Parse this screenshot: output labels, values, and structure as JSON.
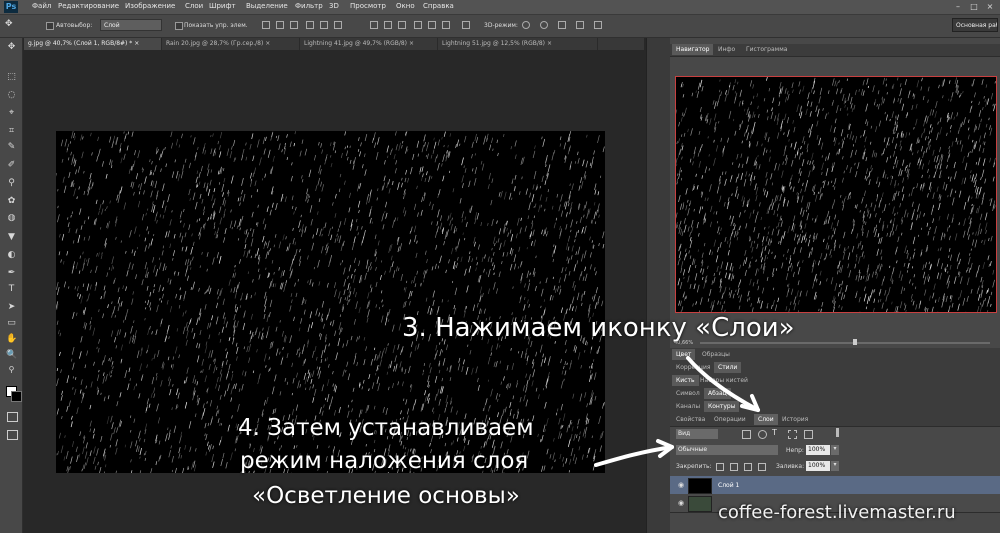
{
  "app": {
    "logo": "Ps"
  },
  "menu": [
    "Файл",
    "Редактирование",
    "Изображение",
    "Слои",
    "Шрифт",
    "Выделение",
    "Фильтр",
    "3D",
    "Просмотр",
    "Окно",
    "Справка"
  ],
  "window_controls": [
    "–",
    "□",
    "×"
  ],
  "options_bar": {
    "autoselect_label": "Автовыбор:",
    "autoselect_value": "Слой",
    "show_transform_label": "Показать упр. элем.",
    "mode_3d_label": "3D-режим:",
    "workspace": "Основная раб"
  },
  "doc_tabs": [
    {
      "label": "g.jpg @ 40,7% (Слой 1, RGB/8#) *",
      "close": "×"
    },
    {
      "label": "Rain 20.jpg @ 28,7% (Гр.сер./8)",
      "close": "×"
    },
    {
      "label": "Lightning 41.jpg @ 49,7% (RGB/8)",
      "close": "×"
    },
    {
      "label": "Lightning 51.jpg @ 12,5% (RGB/8)",
      "close": "×"
    }
  ],
  "tools": [
    "✥",
    "⬚",
    "◌",
    "⌖",
    "⌗",
    "✎",
    "✐",
    "⚲",
    "✿",
    "◍",
    "▼",
    "◐",
    "✒",
    "T",
    "➤",
    "▭",
    "✋",
    "🔍"
  ],
  "panels": {
    "nav_tabs": [
      "Навигатор",
      "Инфо",
      "Гистограмма"
    ],
    "zoom": "40,66%",
    "color_tabs": [
      "Цвет",
      "Образцы"
    ],
    "correction_tabs": [
      "Коррекция",
      "Стили"
    ],
    "brush_tabs": [
      "Кисть",
      "Наборы кистей"
    ],
    "symbol_tabs": [
      "Символ",
      "Абзац"
    ],
    "channel_tabs": [
      "Каналы",
      "Контуры"
    ],
    "layer_panel_tabs": [
      "Свойства",
      "Операции",
      "Слои",
      "История"
    ],
    "kind_filter": "Вид",
    "blend_mode": "Обычные",
    "opacity_label": "Непр:",
    "opacity_value": "100%",
    "lock_label": "Закрепить:",
    "fill_label": "Заливка:",
    "fill_value": "100%",
    "layers": [
      {
        "name": "Слой 1",
        "selected": true
      },
      {
        "name": "",
        "selected": false
      }
    ]
  },
  "annotations": {
    "step3": "3. Нажимаем иконку «Слои»",
    "step4_line1": "4. Затем устанавливаем",
    "step4_line2": "режим наложения слоя",
    "step4_line3": "«Осветление основы»"
  },
  "watermark": "coffee-forest.livemaster.ru"
}
